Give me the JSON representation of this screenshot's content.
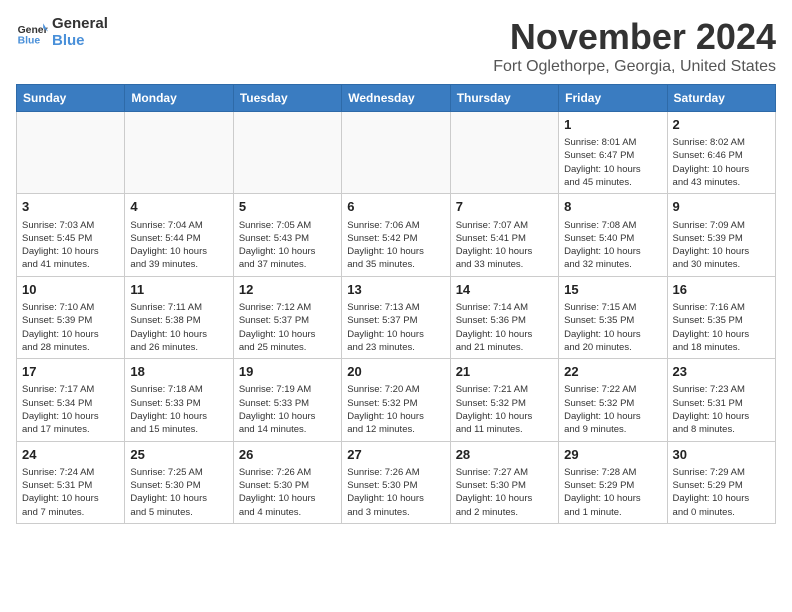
{
  "logo": {
    "line1": "General",
    "line2": "Blue"
  },
  "title": "November 2024",
  "location": "Fort Oglethorpe, Georgia, United States",
  "weekdays": [
    "Sunday",
    "Monday",
    "Tuesday",
    "Wednesday",
    "Thursday",
    "Friday",
    "Saturday"
  ],
  "weeks": [
    [
      {
        "day": "",
        "info": ""
      },
      {
        "day": "",
        "info": ""
      },
      {
        "day": "",
        "info": ""
      },
      {
        "day": "",
        "info": ""
      },
      {
        "day": "",
        "info": ""
      },
      {
        "day": "1",
        "info": "Sunrise: 8:01 AM\nSunset: 6:47 PM\nDaylight: 10 hours\nand 45 minutes."
      },
      {
        "day": "2",
        "info": "Sunrise: 8:02 AM\nSunset: 6:46 PM\nDaylight: 10 hours\nand 43 minutes."
      }
    ],
    [
      {
        "day": "3",
        "info": "Sunrise: 7:03 AM\nSunset: 5:45 PM\nDaylight: 10 hours\nand 41 minutes."
      },
      {
        "day": "4",
        "info": "Sunrise: 7:04 AM\nSunset: 5:44 PM\nDaylight: 10 hours\nand 39 minutes."
      },
      {
        "day": "5",
        "info": "Sunrise: 7:05 AM\nSunset: 5:43 PM\nDaylight: 10 hours\nand 37 minutes."
      },
      {
        "day": "6",
        "info": "Sunrise: 7:06 AM\nSunset: 5:42 PM\nDaylight: 10 hours\nand 35 minutes."
      },
      {
        "day": "7",
        "info": "Sunrise: 7:07 AM\nSunset: 5:41 PM\nDaylight: 10 hours\nand 33 minutes."
      },
      {
        "day": "8",
        "info": "Sunrise: 7:08 AM\nSunset: 5:40 PM\nDaylight: 10 hours\nand 32 minutes."
      },
      {
        "day": "9",
        "info": "Sunrise: 7:09 AM\nSunset: 5:39 PM\nDaylight: 10 hours\nand 30 minutes."
      }
    ],
    [
      {
        "day": "10",
        "info": "Sunrise: 7:10 AM\nSunset: 5:39 PM\nDaylight: 10 hours\nand 28 minutes."
      },
      {
        "day": "11",
        "info": "Sunrise: 7:11 AM\nSunset: 5:38 PM\nDaylight: 10 hours\nand 26 minutes."
      },
      {
        "day": "12",
        "info": "Sunrise: 7:12 AM\nSunset: 5:37 PM\nDaylight: 10 hours\nand 25 minutes."
      },
      {
        "day": "13",
        "info": "Sunrise: 7:13 AM\nSunset: 5:37 PM\nDaylight: 10 hours\nand 23 minutes."
      },
      {
        "day": "14",
        "info": "Sunrise: 7:14 AM\nSunset: 5:36 PM\nDaylight: 10 hours\nand 21 minutes."
      },
      {
        "day": "15",
        "info": "Sunrise: 7:15 AM\nSunset: 5:35 PM\nDaylight: 10 hours\nand 20 minutes."
      },
      {
        "day": "16",
        "info": "Sunrise: 7:16 AM\nSunset: 5:35 PM\nDaylight: 10 hours\nand 18 minutes."
      }
    ],
    [
      {
        "day": "17",
        "info": "Sunrise: 7:17 AM\nSunset: 5:34 PM\nDaylight: 10 hours\nand 17 minutes."
      },
      {
        "day": "18",
        "info": "Sunrise: 7:18 AM\nSunset: 5:33 PM\nDaylight: 10 hours\nand 15 minutes."
      },
      {
        "day": "19",
        "info": "Sunrise: 7:19 AM\nSunset: 5:33 PM\nDaylight: 10 hours\nand 14 minutes."
      },
      {
        "day": "20",
        "info": "Sunrise: 7:20 AM\nSunset: 5:32 PM\nDaylight: 10 hours\nand 12 minutes."
      },
      {
        "day": "21",
        "info": "Sunrise: 7:21 AM\nSunset: 5:32 PM\nDaylight: 10 hours\nand 11 minutes."
      },
      {
        "day": "22",
        "info": "Sunrise: 7:22 AM\nSunset: 5:32 PM\nDaylight: 10 hours\nand 9 minutes."
      },
      {
        "day": "23",
        "info": "Sunrise: 7:23 AM\nSunset: 5:31 PM\nDaylight: 10 hours\nand 8 minutes."
      }
    ],
    [
      {
        "day": "24",
        "info": "Sunrise: 7:24 AM\nSunset: 5:31 PM\nDaylight: 10 hours\nand 7 minutes."
      },
      {
        "day": "25",
        "info": "Sunrise: 7:25 AM\nSunset: 5:30 PM\nDaylight: 10 hours\nand 5 minutes."
      },
      {
        "day": "26",
        "info": "Sunrise: 7:26 AM\nSunset: 5:30 PM\nDaylight: 10 hours\nand 4 minutes."
      },
      {
        "day": "27",
        "info": "Sunrise: 7:26 AM\nSunset: 5:30 PM\nDaylight: 10 hours\nand 3 minutes."
      },
      {
        "day": "28",
        "info": "Sunrise: 7:27 AM\nSunset: 5:30 PM\nDaylight: 10 hours\nand 2 minutes."
      },
      {
        "day": "29",
        "info": "Sunrise: 7:28 AM\nSunset: 5:29 PM\nDaylight: 10 hours\nand 1 minute."
      },
      {
        "day": "30",
        "info": "Sunrise: 7:29 AM\nSunset: 5:29 PM\nDaylight: 10 hours\nand 0 minutes."
      }
    ]
  ]
}
